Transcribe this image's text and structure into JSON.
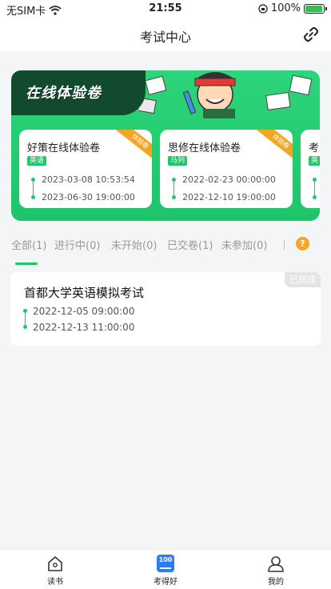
{
  "status_bar": {
    "carrier": "无SIM卡",
    "wifi_icon": "wifi-icon",
    "time": "21:55",
    "orientation_lock_icon": "orientation-lock-icon",
    "battery_percent": "100%",
    "battery_level": 1.0
  },
  "nav": {
    "title": "考试中心",
    "link_icon": "link-icon"
  },
  "banner": {
    "title": "在线体验卷",
    "cards": [
      {
        "name": "好策在线体验卷",
        "tag": "英语",
        "ribbon": "体验卷",
        "start": "2023-03-08 10:53:54",
        "end": "2023-06-30 19:00:00"
      },
      {
        "name": "思修在线体验卷",
        "tag": "马列",
        "ribbon": "体验卷",
        "start": "2022-02-23 00:00:00",
        "end": "2022-12-10 19:00:00"
      },
      {
        "name": "考",
        "tag": "英",
        "ribbon": "",
        "start": "",
        "end": ""
      }
    ]
  },
  "filters": {
    "tabs": [
      "全部(1)",
      "进行中(0)",
      "未开始(0)",
      "已交卷(1)",
      "未参加(0)"
    ],
    "active_index": 0,
    "help_label": "?"
  },
  "exams": [
    {
      "title": "首都大学英语模拟考试",
      "status": "已完成",
      "start": "2022-12-05 09:00:00",
      "end": "2022-12-13 11:00:00"
    }
  ],
  "tab_bar": {
    "items": [
      {
        "label": "读书",
        "icon": "home-icon"
      },
      {
        "label": "考得好",
        "icon": "score-100-icon"
      },
      {
        "label": "我的",
        "icon": "person-icon"
      }
    ],
    "active_index": 1
  },
  "colors": {
    "accent_green": "#20c768",
    "banner_dark": "#114a2c",
    "ribbon_orange": "#f4a623",
    "help_orange": "#f5a623",
    "tab_blue": "#2b7cf6"
  }
}
